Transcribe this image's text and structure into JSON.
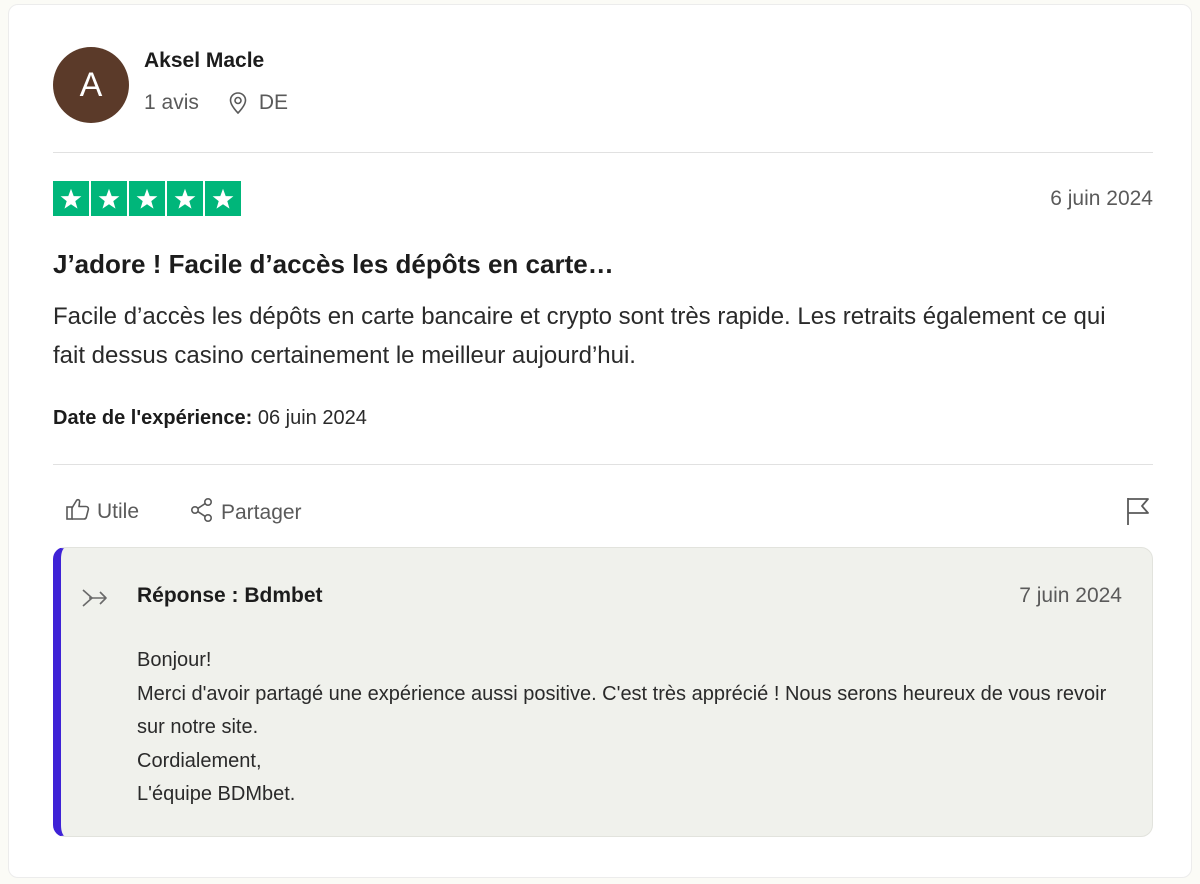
{
  "reviewer": {
    "initial": "A",
    "name": "Aksel Macle",
    "reviews_count": "1 avis",
    "country": "DE",
    "avatar_color": "#5b3a29"
  },
  "review": {
    "rating": 5,
    "max_rating": 5,
    "star_color": "#00b67a",
    "date": "6 juin 2024",
    "title": "J’adore ! Facile d’accès les dépôts en carte…",
    "body": "Facile d’accès les dépôts en carte bancaire et crypto sont très rapide. Les retraits également ce qui fait dessus casino certainement le meilleur aujourd’hui.",
    "experience_label": "Date de l'expérience:",
    "experience_date": "06 juin 2024"
  },
  "actions": {
    "useful_label": "Utile",
    "share_label": "Partager",
    "report_icon": "flag-icon"
  },
  "reply": {
    "author": "Réponse : Bdmbet",
    "date": "7 juin 2024",
    "accent_color": "#3e22d6",
    "lines": [
      "Bonjour!",
      "Merci d'avoir partagé une expérience aussi positive. C'est très apprécié ! Nous serons heureux de vous revoir sur notre site.",
      "Cordialement,",
      "L'équipe BDMbet."
    ]
  }
}
